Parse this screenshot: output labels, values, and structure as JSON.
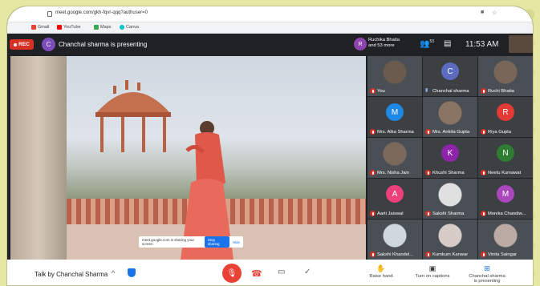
{
  "browser": {
    "url": "meet.google.com/gkh-fqvr-qqq?authuser=0",
    "bookmarks": [
      {
        "label": "Gmail",
        "color": "#ea4335"
      },
      {
        "label": "YouTube",
        "color": "#ff0000"
      },
      {
        "label": "Maps",
        "color": "#34a853"
      },
      {
        "label": "Canva",
        "color": "#00c4cc"
      }
    ]
  },
  "topbar": {
    "rec_label": "REC",
    "presenter_initial": "C",
    "presenting_text": "Chanchal sharma is presenting",
    "people_initial": "R",
    "people_line1": "Ruchika Bhatia",
    "people_line2": "and 53 more",
    "people_count": "53",
    "time": "11:53 AM"
  },
  "share_bar": {
    "message": "meet.google.com is sharing your screen.",
    "stop_label": "Stop sharing",
    "hide_label": "Hide"
  },
  "participants": [
    {
      "name": "You",
      "initial": "",
      "color": "#6b5a4e",
      "photo": true,
      "muted": true
    },
    {
      "name": "Chanchal sharma",
      "initial": "C",
      "color": "#5c6bc0",
      "photo": false,
      "muted": false
    },
    {
      "name": "Ruchi Bhatia",
      "initial": "",
      "color": "#7a6658",
      "photo": true,
      "muted": true
    },
    {
      "name": "Mrs. Alka Sharma",
      "initial": "M",
      "color": "#1e88e5",
      "photo": false,
      "muted": true
    },
    {
      "name": "Mrs. Ankita Gupta",
      "initial": "",
      "color": "#8a7464",
      "photo": true,
      "muted": true
    },
    {
      "name": "Riya Gupta",
      "initial": "R",
      "color": "#e53935",
      "photo": false,
      "muted": true
    },
    {
      "name": "Mrs. Nisha Jain",
      "initial": "",
      "color": "#7b6a5c",
      "photo": true,
      "muted": true
    },
    {
      "name": "Khushi Sharma",
      "initial": "K",
      "color": "#8e24aa",
      "photo": false,
      "muted": true
    },
    {
      "name": "Neetu Kumawat",
      "initial": "N",
      "color": "#2e7d32",
      "photo": false,
      "muted": true
    },
    {
      "name": "Aarti Jaiswal",
      "initial": "A",
      "color": "#ec407a",
      "photo": false,
      "muted": true
    },
    {
      "name": "Sakshi Sharma",
      "initial": "",
      "color": "#e0e0e0",
      "photo": true,
      "muted": true
    },
    {
      "name": "Monika Chandiw...",
      "initial": "M",
      "color": "#ab47bc",
      "photo": false,
      "muted": true
    },
    {
      "name": "Sakshi Khandel...",
      "initial": "",
      "color": "#cfd8dc",
      "photo": true,
      "muted": true
    },
    {
      "name": "Kumkum Kanwar",
      "initial": "",
      "color": "#d7ccc8",
      "photo": true,
      "muted": true
    },
    {
      "name": "Vinita Saingar",
      "initial": "",
      "color": "#bcaaa4",
      "photo": true,
      "muted": true
    }
  ],
  "bottombar": {
    "meeting_name": "Talk by Chanchal Sharma",
    "raise_hand": "Raise hand",
    "captions": "Turn on captions",
    "presenting_line1": "Chanchal sharma",
    "presenting_line2": "is presenting"
  }
}
